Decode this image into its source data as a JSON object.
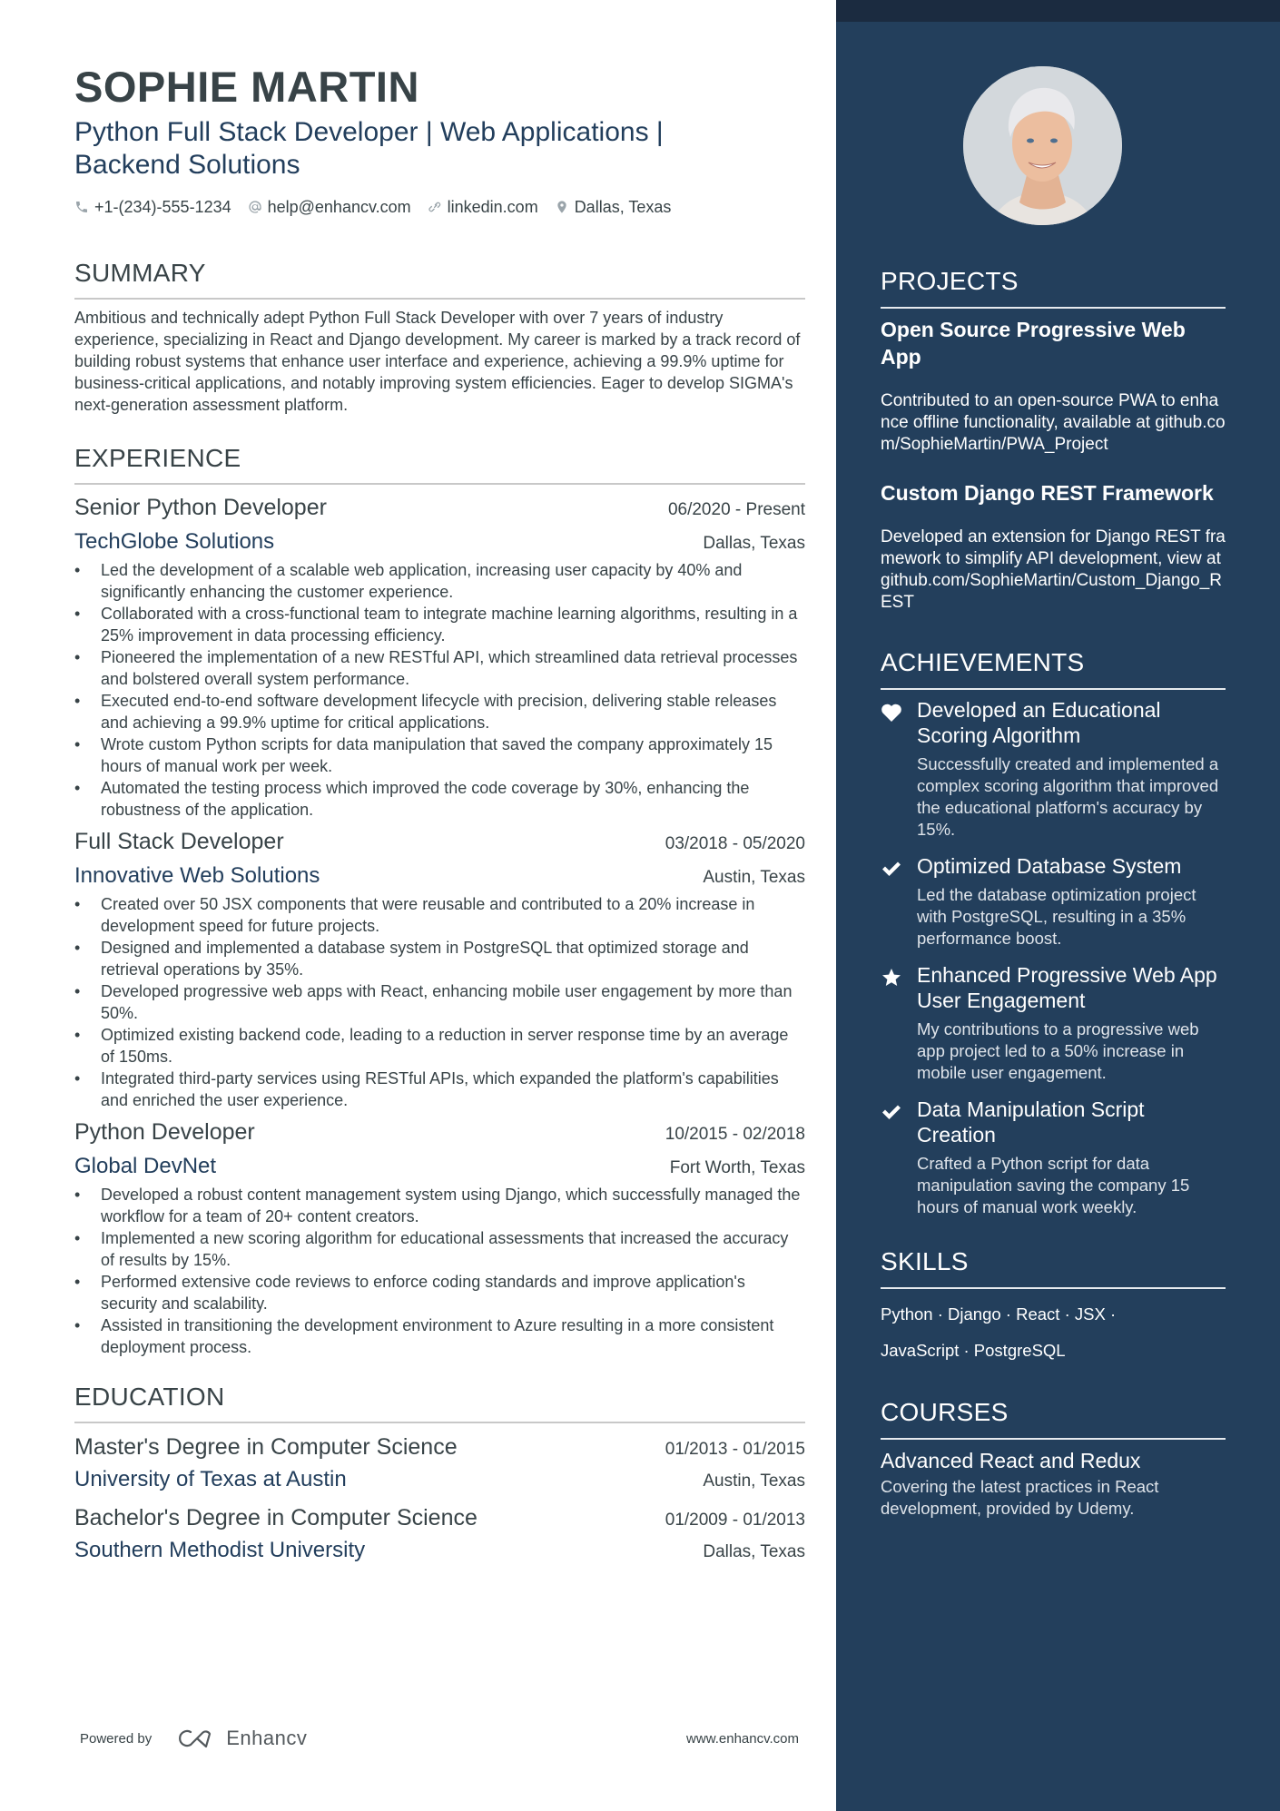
{
  "header": {
    "name": "SOPHIE MARTIN",
    "headline": "Python Full Stack Developer | Web Applications | Backend Solutions",
    "contacts": {
      "phone": "+1-(234)-555-1234",
      "email": "help@enhancv.com",
      "link": "linkedin.com",
      "location": "Dallas, Texas"
    }
  },
  "summary": {
    "title": "SUMMARY",
    "text": "Ambitious and technically adept Python Full Stack Developer with over 7 years of industry experience, specializing in React and Django development. My career is marked by a track record of building robust systems that enhance user interface and experience, achieving a 99.9% uptime for business-critical applications, and notably improving system efficiencies. Eager to develop SIGMA's next-generation assessment platform."
  },
  "experience": {
    "title": "EXPERIENCE",
    "jobs": [
      {
        "title": "Senior Python Developer",
        "dates": "06/2020 - Present",
        "company": "TechGlobe Solutions",
        "location": "Dallas, Texas",
        "bullets": [
          "Led the development of a scalable web application, increasing user capacity by 40% and significantly enhancing the customer experience.",
          "Collaborated with a cross-functional team to integrate machine learning algorithms, resulting in a 25% improvement in data processing efficiency.",
          "Pioneered the implementation of a new RESTful API, which streamlined data retrieval processes and bolstered overall system performance.",
          "Executed end-to-end software development lifecycle with precision, delivering stable releases and achieving a 99.9% uptime for critical applications.",
          "Wrote custom Python scripts for data manipulation that saved the company approximately 15 hours of manual work per week.",
          "Automated the testing process which improved the code coverage by 30%, enhancing the robustness of the application."
        ]
      },
      {
        "title": "Full Stack Developer",
        "dates": "03/2018 - 05/2020",
        "company": "Innovative Web Solutions",
        "location": "Austin, Texas",
        "bullets": [
          "Created over 50 JSX components that were reusable and contributed to a 20% increase in development speed for future projects.",
          "Designed and implemented a database system in PostgreSQL that optimized storage and retrieval operations by 35%.",
          "Developed progressive web apps with React, enhancing mobile user engagement by more than 50%.",
          "Optimized existing backend code, leading to a reduction in server response time by an average of 150ms.",
          "Integrated third-party services using RESTful APIs, which expanded the platform's capabilities and enriched the user experience."
        ]
      },
      {
        "title": "Python Developer",
        "dates": "10/2015 - 02/2018",
        "company": "Global DevNet",
        "location": "Fort Worth, Texas",
        "bullets": [
          "Developed a robust content management system using Django, which successfully managed the workflow for a team of 20+ content creators.",
          "Implemented a new scoring algorithm for educational assessments that increased the accuracy of results by 15%.",
          "Performed extensive code reviews to enforce coding standards and improve application's security and scalability.",
          "Assisted in transitioning the development environment to Azure resulting in a more consistent deployment process."
        ]
      }
    ]
  },
  "education": {
    "title": "EDUCATION",
    "items": [
      {
        "degree": "Master's Degree in Computer Science",
        "dates": "01/2013 - 01/2015",
        "school": "University of Texas at Austin",
        "location": "Austin, Texas"
      },
      {
        "degree": "Bachelor's Degree in Computer Science",
        "dates": "01/2009 - 01/2013",
        "school": "Southern Methodist University",
        "location": "Dallas, Texas"
      }
    ]
  },
  "footer": {
    "powered_by": "Powered by",
    "brand": "Enhancv",
    "website": "www.enhancv.com"
  },
  "projects": {
    "title": "PROJECTS",
    "items": [
      {
        "title": "Open Source Progressive Web App",
        "description": "Contributed to an open-source PWA to enhance offline functionality, available at github.com/SophieMartin/PWA_Project"
      },
      {
        "title": "Custom Django REST Framework",
        "description": "Developed an extension for Django REST framework to simplify API development, view at github.com/SophieMartin/Custom_Django_REST"
      }
    ]
  },
  "achievements": {
    "title": "ACHIEVEMENTS",
    "items": [
      {
        "icon": "heart-icon",
        "title": "Developed an Educational Scoring Algorithm",
        "description": "Successfully created and implemented a complex scoring algorithm that improved the educational platform's accuracy by 15%."
      },
      {
        "icon": "check-icon",
        "title": "Optimized Database System",
        "description": "Led the database optimization project with PostgreSQL, resulting in a 35% performance boost."
      },
      {
        "icon": "star-icon",
        "title": "Enhanced Progressive Web App User Engagement",
        "description": "My contributions to a progressive web app project led to a 50% increase in mobile user engagement."
      },
      {
        "icon": "check-icon",
        "title": "Data Manipulation Script Creation",
        "description": "Crafted a Python script for data manipulation saving the company 15 hours of manual work weekly."
      }
    ]
  },
  "skills": {
    "title": "SKILLS",
    "line1": "Python · Django · React · JSX ·",
    "line2": "JavaScript · PostgreSQL"
  },
  "courses": {
    "title": "COURSES",
    "items": [
      {
        "title": "Advanced React and Redux",
        "description": "Covering the latest practices in React development, provided by Udemy."
      }
    ]
  },
  "colors": {
    "sidebar": "#233f5c",
    "sidebar_top": "#1b2b40",
    "accent": "#223e5c",
    "text": "#384347"
  }
}
